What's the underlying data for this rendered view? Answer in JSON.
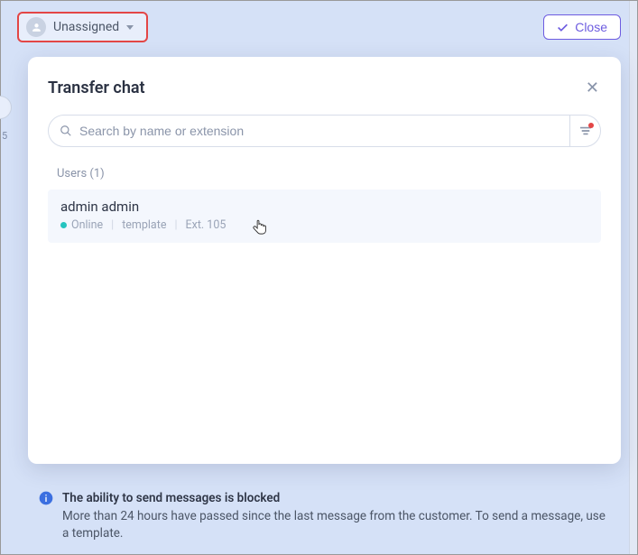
{
  "topbar": {
    "assignee_label": "Unassigned",
    "close_label": "Close"
  },
  "modal": {
    "title": "Transfer chat",
    "search_placeholder": "Search by name or extension",
    "group_label": "Users (1)",
    "users": [
      {
        "name": "admin admin",
        "status": "Online",
        "status_color": "#25c4bf",
        "role": "template",
        "extension": "Ext. 105"
      }
    ]
  },
  "banner": {
    "heading": "The ability to send messages is blocked",
    "body": "More than 24 hours have passed since the last message from the customer. To send a message, use a template."
  },
  "left_fragment": "5"
}
